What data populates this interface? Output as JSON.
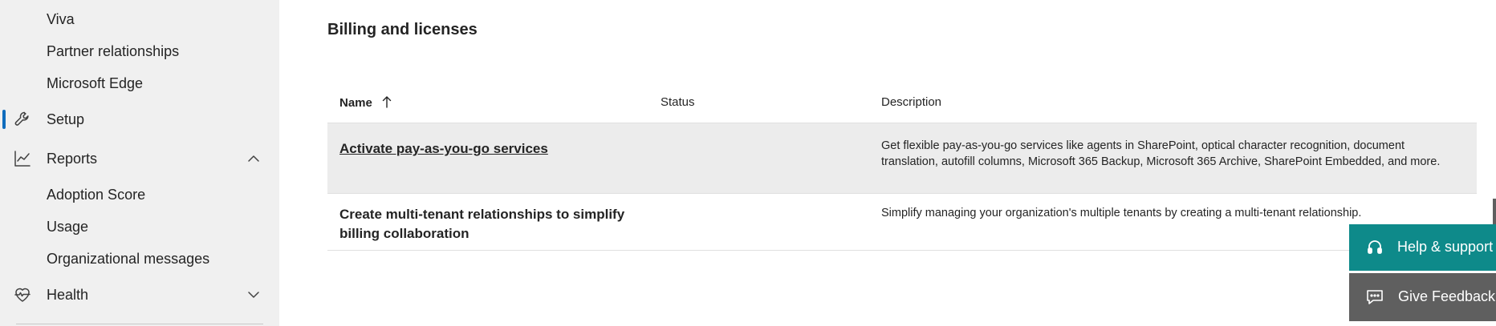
{
  "sidebar": {
    "items": [
      {
        "label": "Viva"
      },
      {
        "label": "Partner relationships"
      },
      {
        "label": "Microsoft Edge"
      },
      {
        "label": "Setup",
        "icon": "wrench-icon",
        "active": true
      },
      {
        "label": "Reports",
        "icon": "chart-icon",
        "expanded": true
      },
      {
        "label": "Adoption Score"
      },
      {
        "label": "Usage"
      },
      {
        "label": "Organizational messages"
      },
      {
        "label": "Health",
        "icon": "heart-pulse-icon",
        "expanded": false
      }
    ],
    "accent_color": "#0f6cbd"
  },
  "main": {
    "title": "Billing and licenses",
    "table": {
      "columns": [
        "Name",
        "Status",
        "Description"
      ],
      "sort_icon": "arrow-up-icon",
      "rows": [
        {
          "name": "Activate pay-as-you-go services",
          "status": "",
          "description": "Get flexible pay-as-you-go services like agents in SharePoint, optical character recognition, document translation, autofill columns, Microsoft 365 Backup, Microsoft 365 Archive, SharePoint Embedded, and more."
        },
        {
          "name": "Create multi-tenant relationships to simplify billing collaboration",
          "status": "",
          "description": "Simplify managing your organization's multiple tenants by creating a multi-tenant relationship."
        }
      ]
    }
  },
  "floating": {
    "help_label": "Help & support",
    "help_icon": "headset-icon",
    "help_color": "#0e8a8a",
    "feedback_label": "Give Feedback",
    "feedback_icon": "feedback-icon",
    "feedback_color": "#5f5f5f"
  }
}
